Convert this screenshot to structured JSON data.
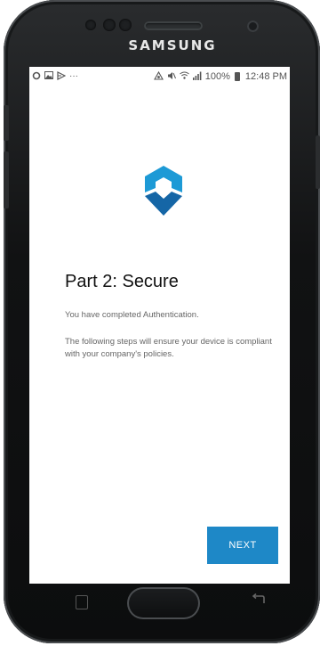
{
  "device": {
    "brand": "SAMSUNG"
  },
  "status_bar": {
    "left_icons": [
      "sync-icon",
      "gallery-icon",
      "cast-icon",
      "more-dots-icon"
    ],
    "right_icons": [
      "nfc-icon",
      "mute-icon",
      "wifi-icon",
      "signal-icon",
      "battery-icon"
    ],
    "battery": "100%",
    "time": "12:48 PM"
  },
  "main": {
    "title": "Part 2: Secure",
    "paragraph1": "You have completed Authentication.",
    "paragraph2": "The following steps will ensure your device is compliant with your company's policies.",
    "next_label": "NEXT"
  },
  "colors": {
    "accent": "#1e88c7",
    "logo_light": "#1d9ad6",
    "logo_dark": "#1566a6"
  }
}
